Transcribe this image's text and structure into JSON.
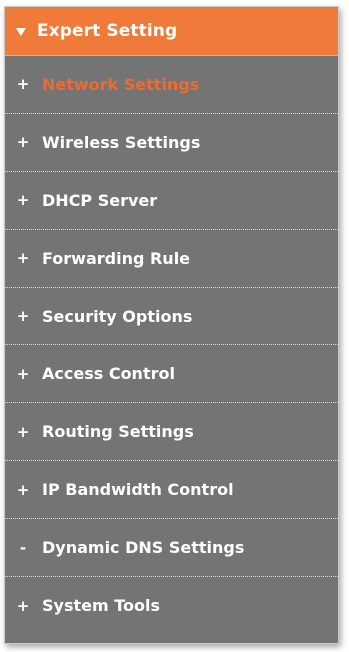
{
  "header": {
    "title": "Expert Setting",
    "icon": "caret-down-icon",
    "accent_color": "#ef7a3a"
  },
  "menu": {
    "items": [
      {
        "sign": "+",
        "label": "Network Settings",
        "active": true
      },
      {
        "sign": "+",
        "label": "Wireless Settings"
      },
      {
        "sign": "+",
        "label": "DHCP Server"
      },
      {
        "sign": "+",
        "label": "Forwarding Rule"
      },
      {
        "sign": "+",
        "label": "Security Options"
      },
      {
        "sign": "+",
        "label": "Access Control"
      },
      {
        "sign": "+",
        "label": "Routing Settings"
      },
      {
        "sign": "+",
        "label": "IP Bandwidth Control"
      },
      {
        "sign": "-",
        "label": "Dynamic DNS Settings"
      },
      {
        "sign": "+",
        "label": "System Tools"
      }
    ],
    "background_color": "#747474",
    "active_text_color": "#ef6a2e"
  }
}
